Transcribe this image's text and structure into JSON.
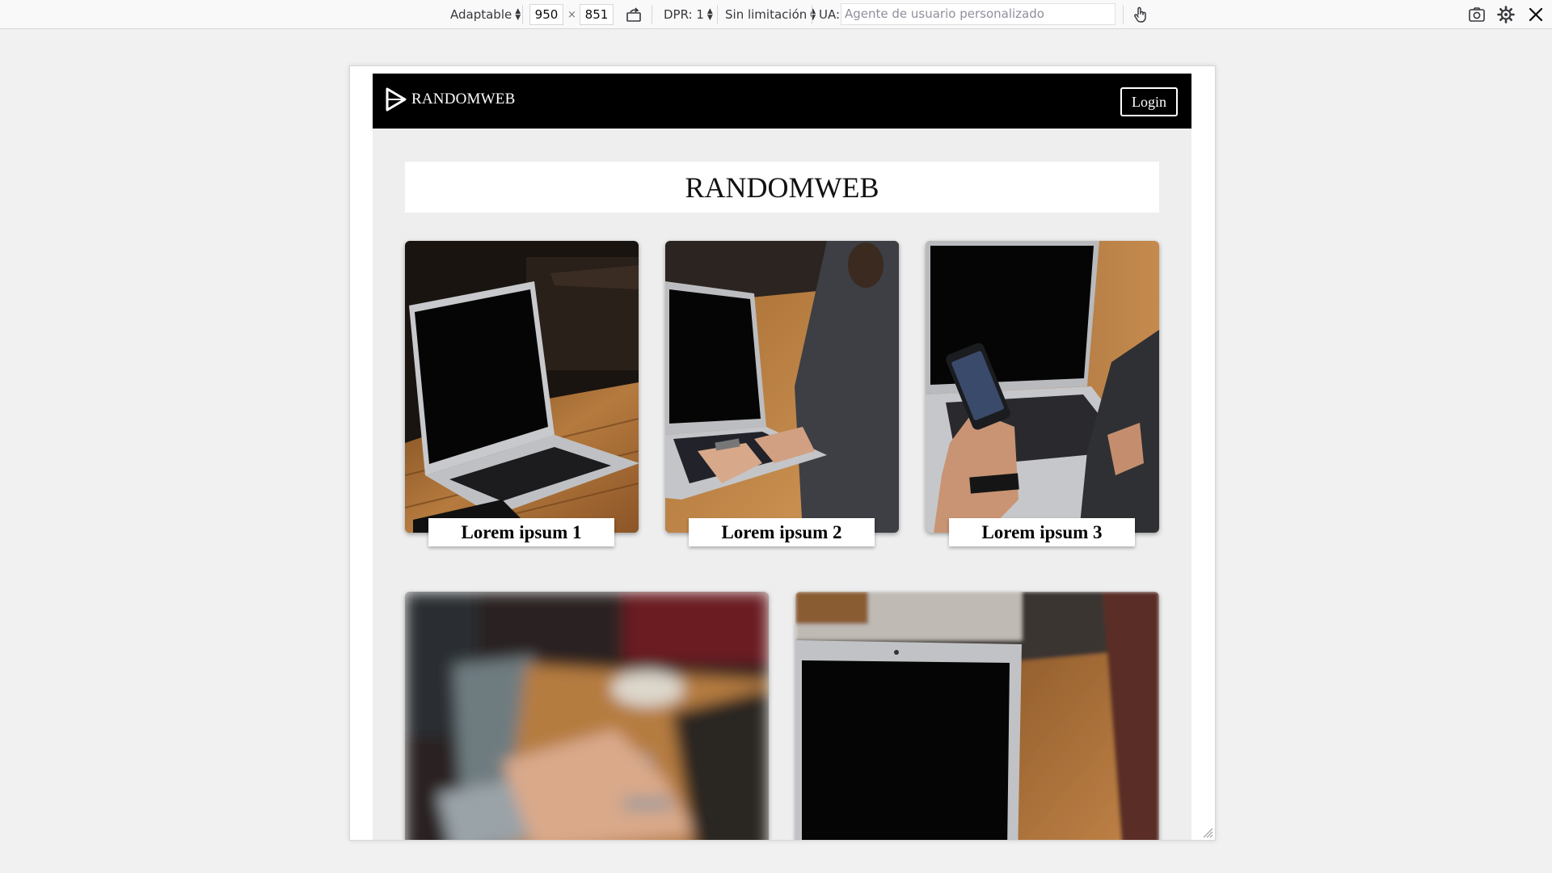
{
  "toolbar": {
    "device": "Adaptable",
    "width": "950",
    "times": "×",
    "height": "851",
    "dpr": "DPR: 1",
    "throttling": "Sin limitación",
    "ua_label": "UA:",
    "ua_placeholder": "Agente de usuario personalizado",
    "icons": [
      "rotate-icon",
      "touch-icon",
      "screenshot-icon",
      "settings-icon",
      "close-icon"
    ]
  },
  "site": {
    "logo_text": "RANDOMWEB",
    "login_label": "Login",
    "hero_title": "RANDOMWEB",
    "cards": [
      {
        "caption": "Lorem ipsum 1",
        "image": "laptop-on-table"
      },
      {
        "caption": "Lorem ipsum 2",
        "image": "person-typing-laptop"
      },
      {
        "caption": "Lorem ipsum 3",
        "image": "hand-holding-phone"
      },
      {
        "caption": "",
        "image": "blurred-hands-typing"
      },
      {
        "caption": "",
        "image": "laptop-front-view"
      }
    ]
  },
  "colors": {
    "nav_background": "#000000",
    "page_background": "#eeeeee",
    "toolbar_background": "#f9f9fa"
  }
}
